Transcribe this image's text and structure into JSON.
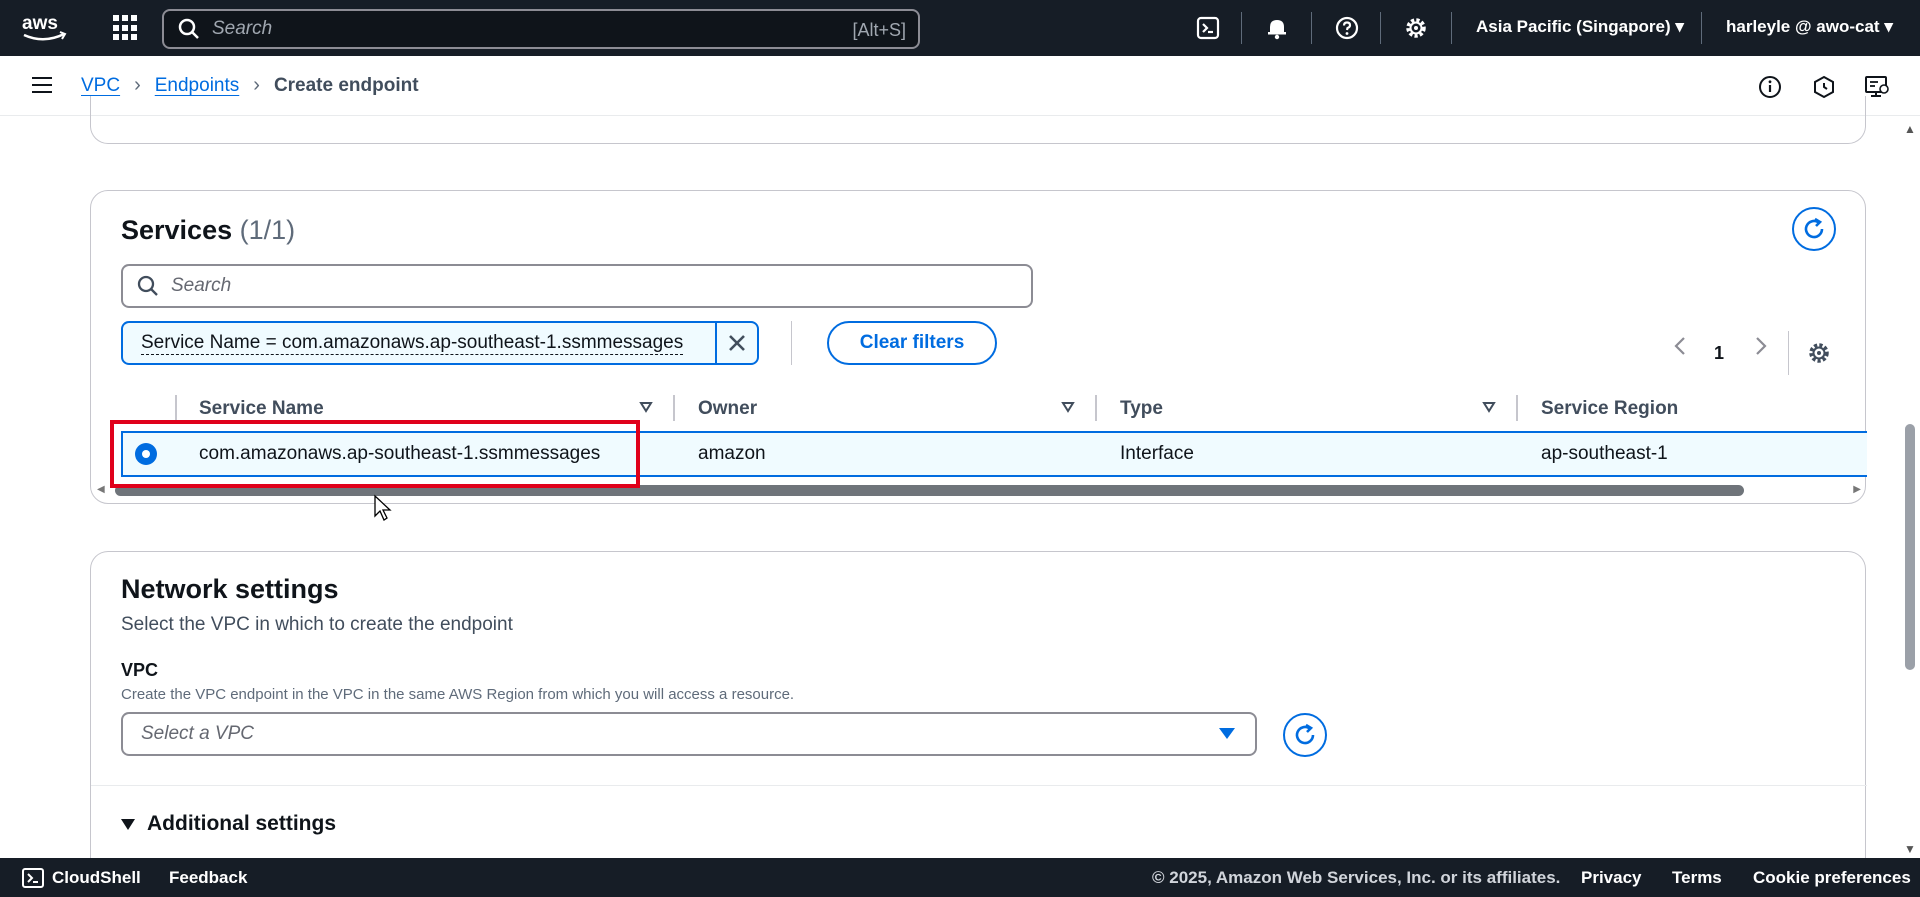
{
  "topnav": {
    "logo_text": "aws",
    "search_placeholder": "Search",
    "search_shortcut": "[Alt+S]",
    "region": "Asia Pacific (Singapore)",
    "user": "harleyle @ awo-cat"
  },
  "breadcrumb": {
    "items": [
      "VPC",
      "Endpoints"
    ],
    "current": "Create endpoint"
  },
  "services": {
    "title": "Services",
    "count": "(1/1)",
    "search_placeholder": "Search",
    "filter_token": "Service Name = com.amazonaws.ap-southeast-1.ssmmessages",
    "clear_filters": "Clear filters",
    "page": "1",
    "columns": [
      "Service Name",
      "Owner",
      "Type",
      "Service Region"
    ],
    "rows": [
      {
        "service_name": "com.amazonaws.ap-southeast-1.ssmmessages",
        "owner": "amazon",
        "type": "Interface",
        "region": "ap-southeast-1",
        "selected": true
      }
    ]
  },
  "network": {
    "title": "Network settings",
    "description": "Select the VPC in which to create the endpoint",
    "vpc_label": "VPC",
    "vpc_help": "Create the VPC endpoint in the VPC in the same AWS Region from which you will access a resource.",
    "vpc_placeholder": "Select a VPC",
    "additional": "Additional settings"
  },
  "footer": {
    "cloudshell": "CloudShell",
    "feedback": "Feedback",
    "copyright": "© 2025, Amazon Web Services, Inc. or its affiliates.",
    "privacy": "Privacy",
    "terms": "Terms",
    "cookies": "Cookie preferences"
  },
  "colors": {
    "nav_bg": "#161d26",
    "accent": "#006ce0",
    "selection_bg": "#f0fbff",
    "highlight": "#e0001a"
  }
}
